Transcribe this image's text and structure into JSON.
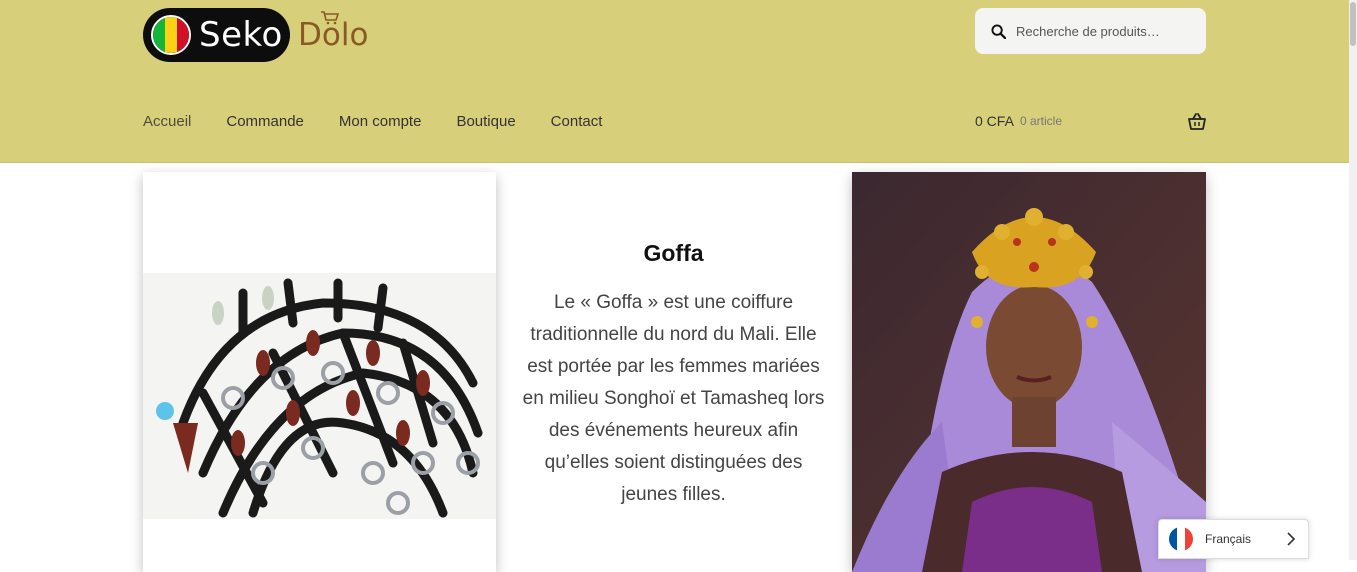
{
  "brand": {
    "name_part1": "Seko",
    "name_part2": "Dolo"
  },
  "search": {
    "placeholder": "Recherche de produits…"
  },
  "nav": {
    "items": [
      "Accueil",
      "Commande",
      "Mon compte",
      "Boutique",
      "Contact"
    ]
  },
  "cart": {
    "total": "0 CFA",
    "count": "0 article"
  },
  "article": {
    "title": "Goffa",
    "body": "Le « Goffa  » est une coiffure traditionnelle du nord du Mali. Elle est portée par les femmes mariées en milieu   Songhoï et Tamasheq lors des événements heureux afin qu’elles soient distinguées des jeunes filles."
  },
  "language": {
    "label": "Français"
  },
  "colors": {
    "header_bg": "#d8cf7b",
    "dolo_brown": "#8a5a24",
    "mali_green": "#14b53a",
    "mali_yellow": "#fcd116",
    "mali_red": "#ce1126"
  },
  "icons": [
    "search-icon",
    "basket-icon",
    "chevron-right-icon",
    "france-flag-icon",
    "mali-flag-icon"
  ]
}
